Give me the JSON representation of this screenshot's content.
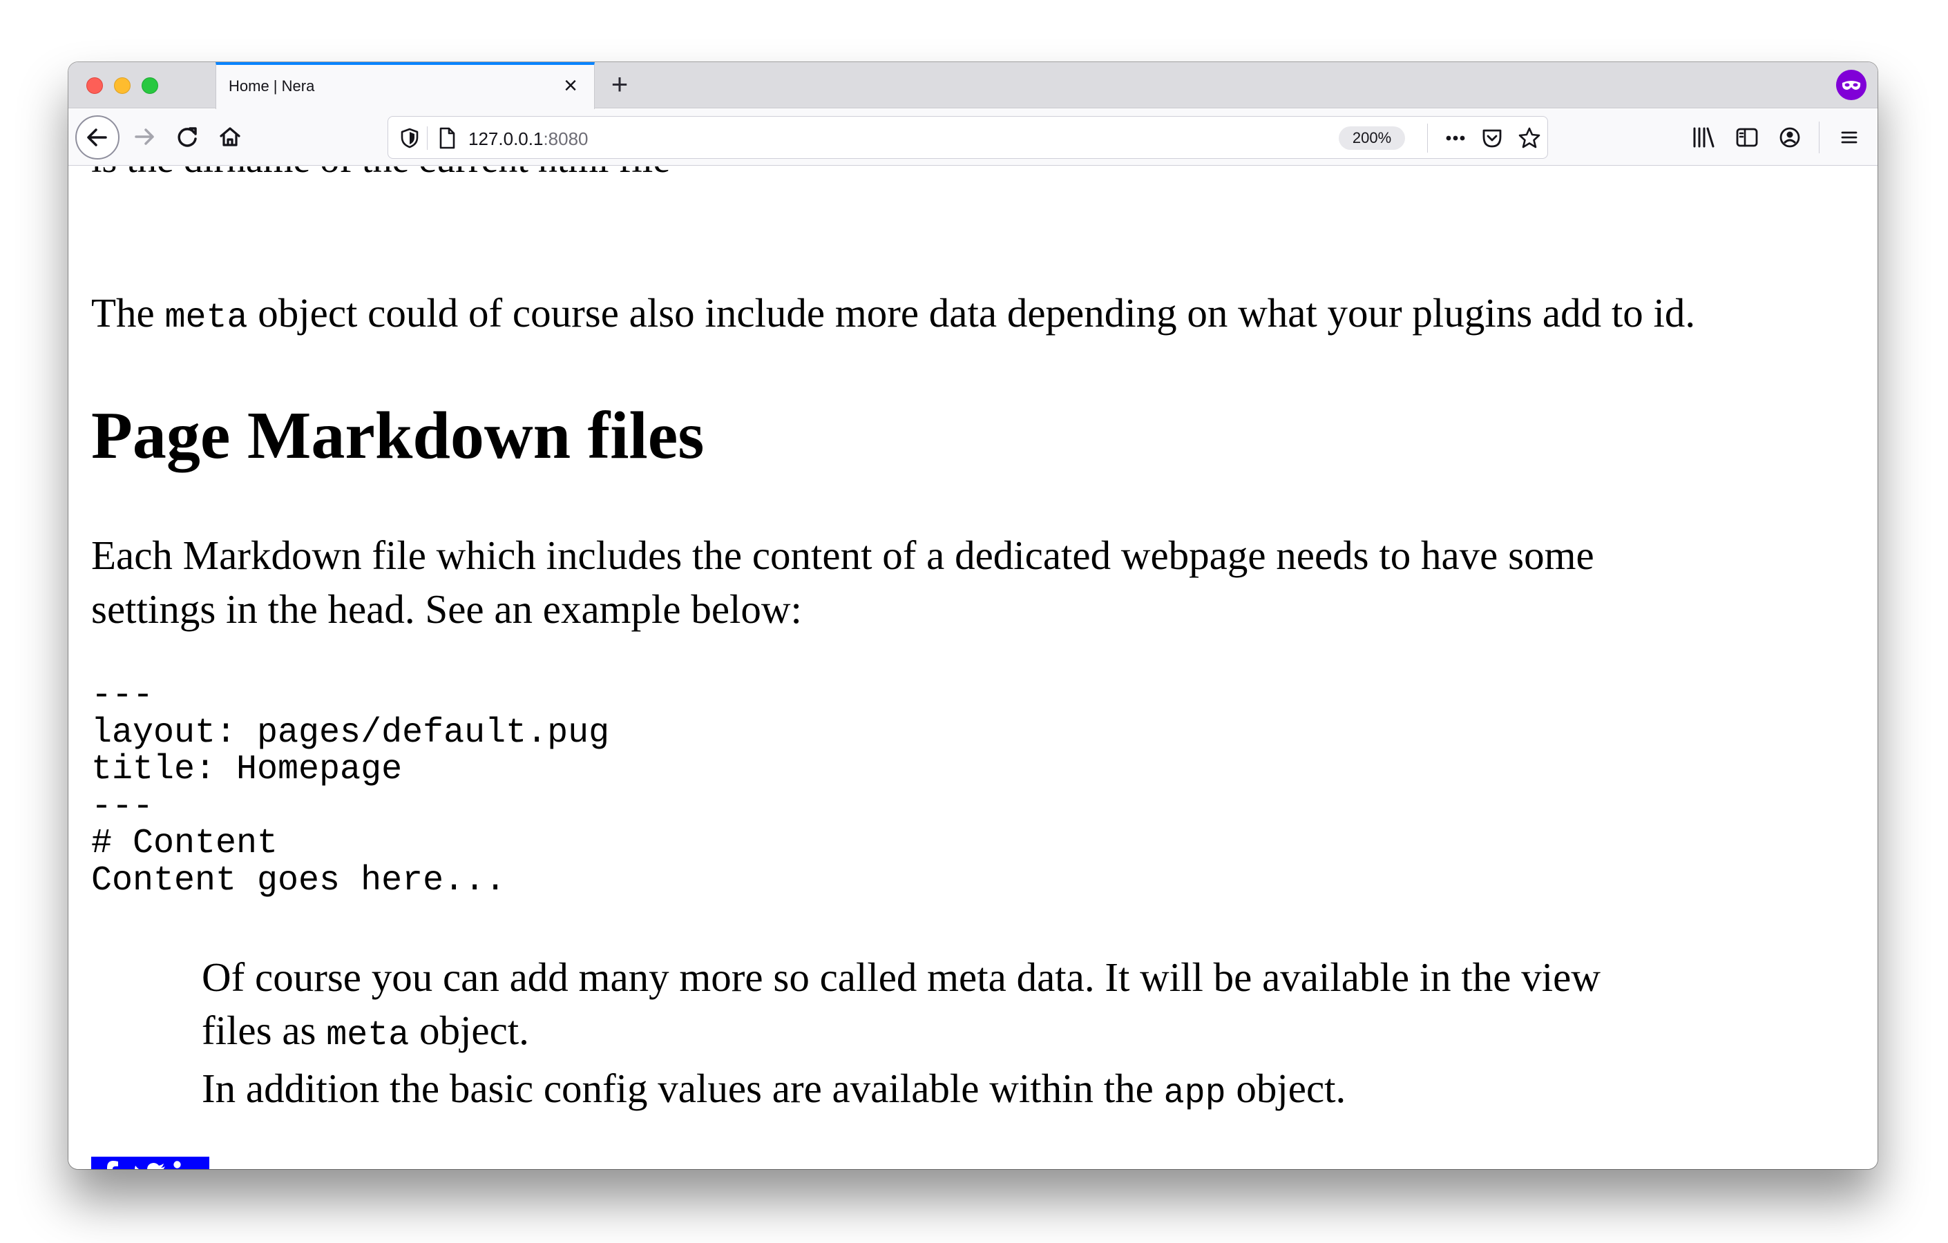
{
  "browser": {
    "tab_title": "Home | Nera",
    "url_host": "127.0.0.1",
    "url_port": ":8080",
    "zoom_level": "200%",
    "tab_close_glyph": "×",
    "new_tab_glyph": "+",
    "private_browsing_icon": "private-mask-icon"
  },
  "page": {
    "cut_off_line": "is the dirname of the current html file",
    "meta_paragraph": {
      "before": "The ",
      "code": "meta",
      "after": " object could of course also include more data depending on what your plugins add to id."
    },
    "heading": "Page Markdown files",
    "example_paragraph": {
      "line1": "Each Markdown file which includes the content of a dedicated webpage needs to have some",
      "line2": "settings in the head. See an example below:"
    },
    "code_block": [
      "---",
      "layout: pages/default.pug",
      "title: Homepage",
      "---",
      "# Content",
      "Content goes here..."
    ],
    "blockquote": {
      "line1": "Of course you can add many more so called meta data. It will be available in the view",
      "line2_before": "files as ",
      "line2_code": "meta",
      "line2_after": " object.",
      "line3_before": "In addition the basic config values are available within the ",
      "line3_code": "app",
      "line3_after": " object."
    },
    "social_icons": [
      "facebook-icon",
      "twitter-icon",
      "linkedin-icon"
    ]
  },
  "colors": {
    "accent_tab": "#0a84ff",
    "social_blue": "#0000ff",
    "private_purple": "#8000d7"
  }
}
